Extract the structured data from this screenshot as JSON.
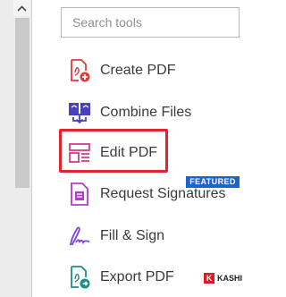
{
  "search": {
    "placeholder": "Search tools"
  },
  "tools": [
    {
      "label": "Create PDF",
      "icon": "create-pdf-icon",
      "color": "#e8383b"
    },
    {
      "label": "Combine Files",
      "icon": "combine-files-icon",
      "color": "#4a3fbd"
    },
    {
      "label": "Edit PDF",
      "icon": "edit-pdf-icon",
      "color": "#d63a8c"
    },
    {
      "label": "Request Signatures",
      "icon": "request-signatures-icon",
      "color": "#b13bd0"
    },
    {
      "label": "Fill & Sign",
      "icon": "fill-sign-icon",
      "color": "#7c45d6"
    },
    {
      "label": "Export PDF",
      "icon": "export-pdf-icon",
      "color": "#1d8f87"
    }
  ],
  "badge": {
    "text": "FEATURED",
    "color": "#1d63c9"
  },
  "highlight_color": "#e0262b",
  "watermark": {
    "logo": "K",
    "text": "KASHI"
  }
}
